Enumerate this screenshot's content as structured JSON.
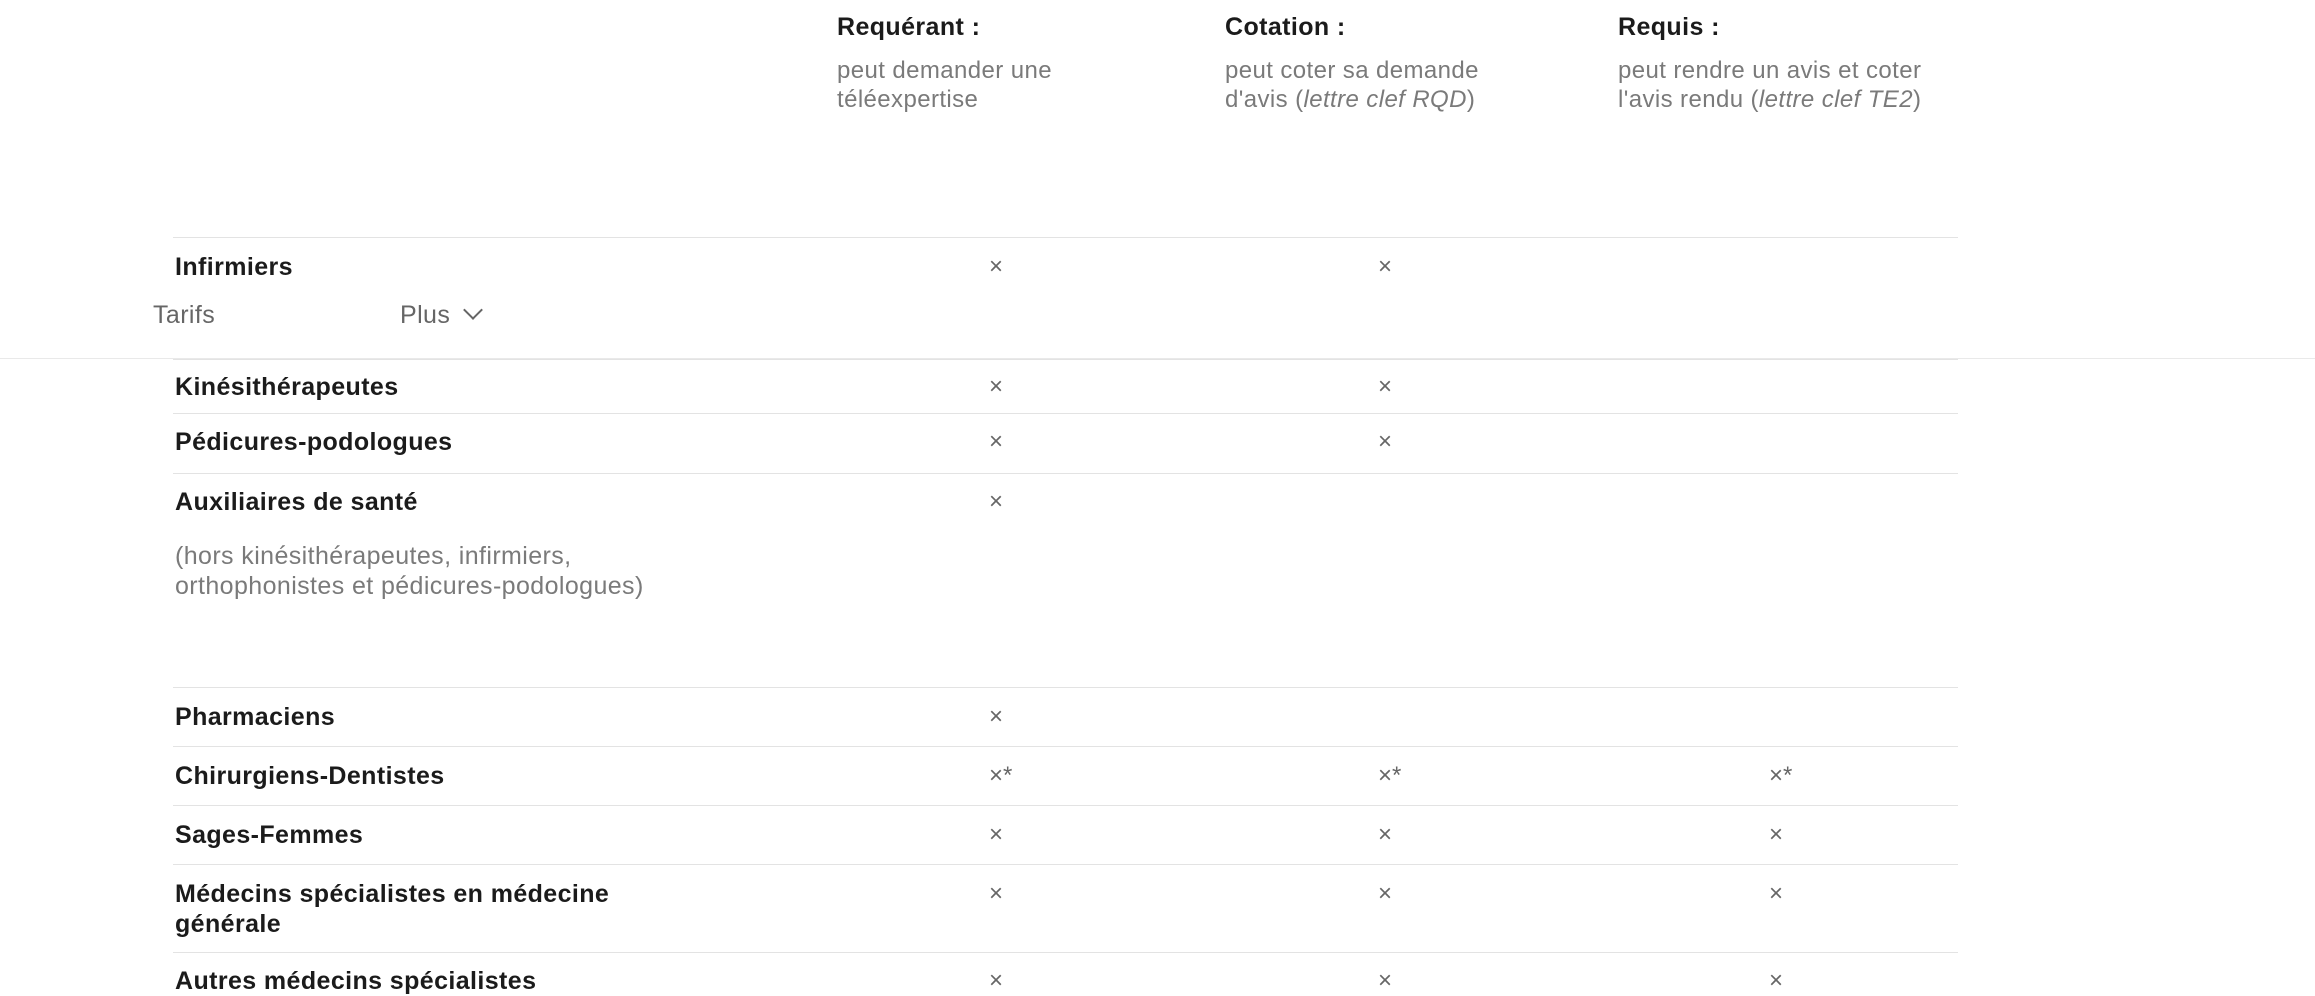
{
  "columns": [
    {
      "title": "Requérant :",
      "desc_parts": [
        {
          "text": "peut demander une téléexpertise",
          "italic": false
        }
      ]
    },
    {
      "title": "Cotation :",
      "desc_parts": [
        {
          "text": "peut coter sa demande d'avis (",
          "italic": false
        },
        {
          "text": "lettre clef RQD",
          "italic": true
        },
        {
          "text": ")",
          "italic": false
        }
      ]
    },
    {
      "title": "Requis :",
      "desc_parts": [
        {
          "text": "peut rendre un avis et coter l'avis rendu (",
          "italic": false
        },
        {
          "text": "lettre clef TE2",
          "italic": true
        },
        {
          "text": ")",
          "italic": false
        }
      ]
    }
  ],
  "navbar": {
    "tarifs_label": "Tarifs",
    "plus_label": "Plus"
  },
  "rows": [
    {
      "label": "Infirmiers",
      "sub": "",
      "marks": [
        "×",
        "×",
        ""
      ]
    },
    {
      "label": "Kinésithérapeutes",
      "sub": "",
      "marks": [
        "×",
        "×",
        ""
      ]
    },
    {
      "label": "Pédicures-podologues",
      "sub": "",
      "marks": [
        "×",
        "×",
        ""
      ]
    },
    {
      "label": "Auxiliaires de santé",
      "sub": "(hors kinésithérapeutes, infirmiers, orthophonistes et pédicures-podologues)",
      "marks": [
        "×",
        "",
        ""
      ]
    },
    {
      "label": "Pharmaciens",
      "sub": "",
      "marks": [
        "×",
        "",
        ""
      ]
    },
    {
      "label": "Chirurgiens-Dentistes",
      "sub": "",
      "marks": [
        "×*",
        "×*",
        "×*"
      ]
    },
    {
      "label": "Sages-Femmes",
      "sub": "",
      "marks": [
        "×",
        "×",
        "×"
      ]
    },
    {
      "label": "Médecins spécialistes en médecine générale",
      "sub": "",
      "marks": [
        "×",
        "×",
        "×"
      ]
    },
    {
      "label": "Autres médecins spécialistes",
      "sub": "",
      "marks": [
        "×",
        "×",
        "×"
      ]
    }
  ]
}
